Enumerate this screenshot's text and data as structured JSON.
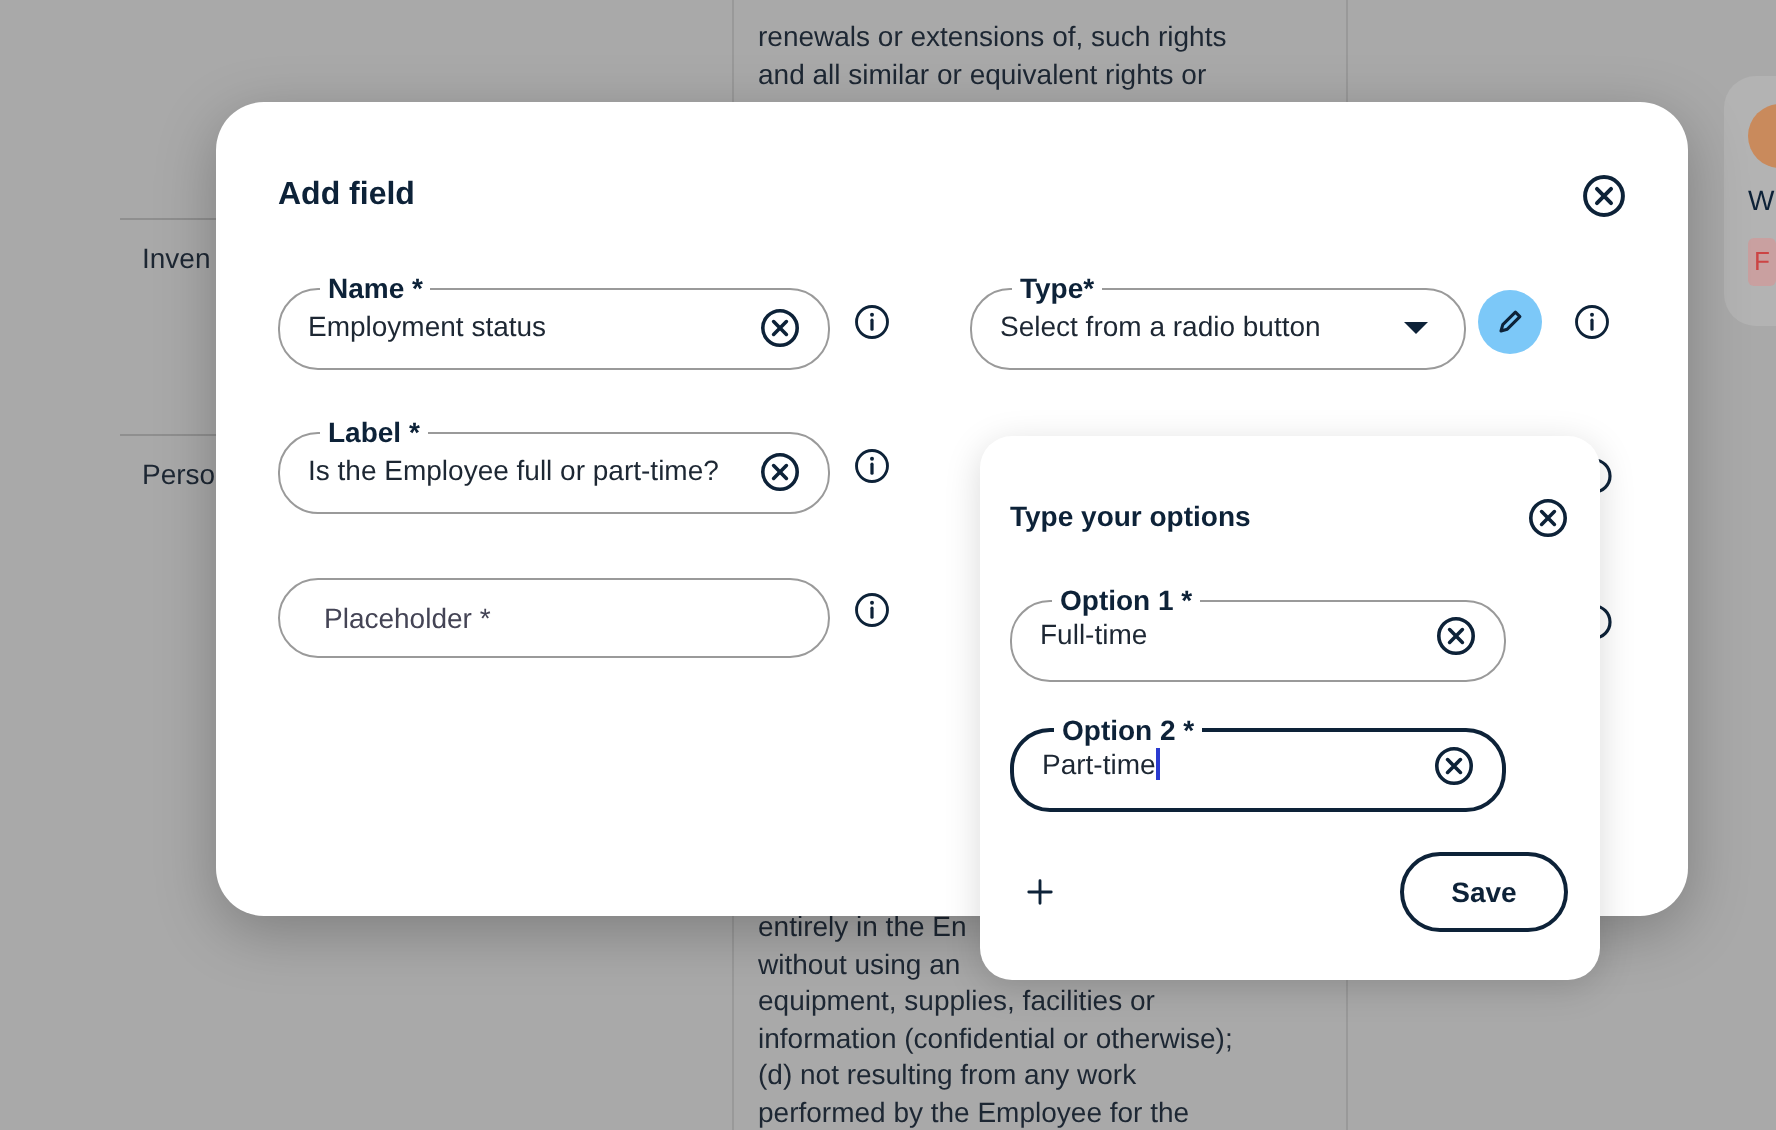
{
  "background": {
    "row_labels": [
      "Inven",
      "Perso"
    ],
    "text_top": [
      "renewals or extensions of, such rights",
      "and all similar or equivalent rights or"
    ],
    "text_bottom": [
      "entirely in the En",
      "without using an",
      "equipment, supplies, facilities or",
      "information (confidential or otherwise);",
      "(d) not resulting from any work",
      "performed by the Employee for the"
    ],
    "side_card": {
      "initial": "W",
      "tag": "F"
    }
  },
  "dialog": {
    "title": "Add field",
    "fields_left": [
      {
        "kind": "text",
        "label": "Name *",
        "value": "Employment status"
      },
      {
        "kind": "text",
        "label": "Label *",
        "value": "Is the Employee full or part-time?"
      },
      {
        "kind": "text",
        "placeholder": "Placeholder *"
      }
    ],
    "type_field": {
      "kind": "select",
      "label": "Type*",
      "value": "Select from a radio button"
    }
  },
  "options_popover": {
    "title": "Type your options",
    "options": [
      {
        "label": "Option 1 *",
        "value": "Full-time",
        "focused": false
      },
      {
        "label": "Option 2 *",
        "value": "Part-time",
        "focused": true
      }
    ],
    "save_label": "Save"
  }
}
